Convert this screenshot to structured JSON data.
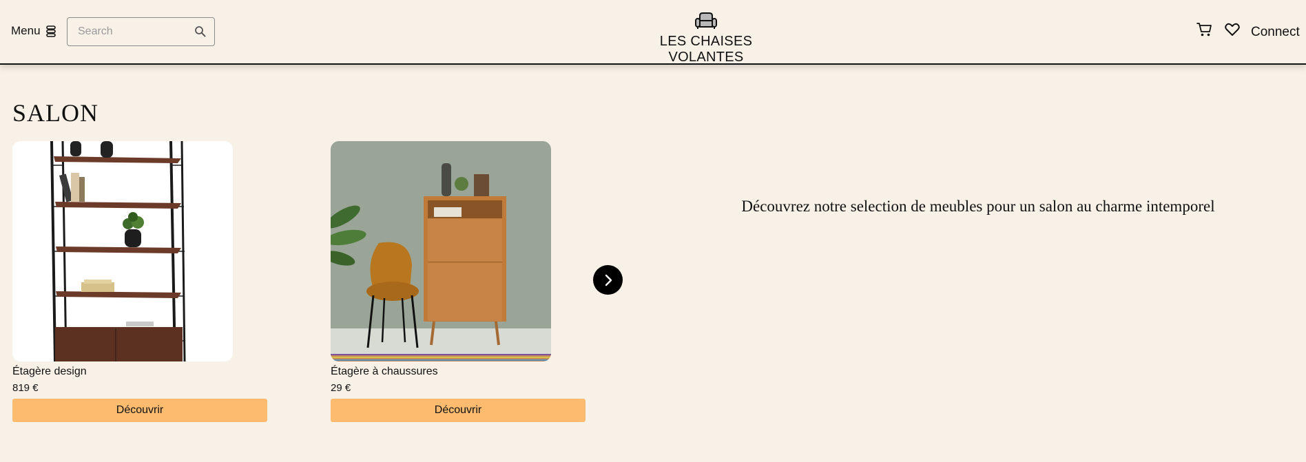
{
  "header": {
    "menu_label": "Menu",
    "search_placeholder": "Search",
    "brand_name": "LES CHAISES VOLANTES",
    "connect_label": "Connect",
    "icons": [
      "menu-icon",
      "search-icon",
      "armchair-logo-icon",
      "cart-icon",
      "heart-icon"
    ]
  },
  "main": {
    "section_title": "SALON",
    "products": [
      {
        "name": "Étagère design",
        "price": "819 €",
        "button_label": "Découvrir"
      },
      {
        "name": "Étagère à chaussures",
        "price": "29 €",
        "button_label": "Découvrir"
      }
    ],
    "tagline": "Découvrez notre selection de meubles pour un salon au charme intemporel"
  },
  "colors": {
    "background": "#f8f1e7",
    "button": "#fdbb70",
    "text": "#111111"
  }
}
